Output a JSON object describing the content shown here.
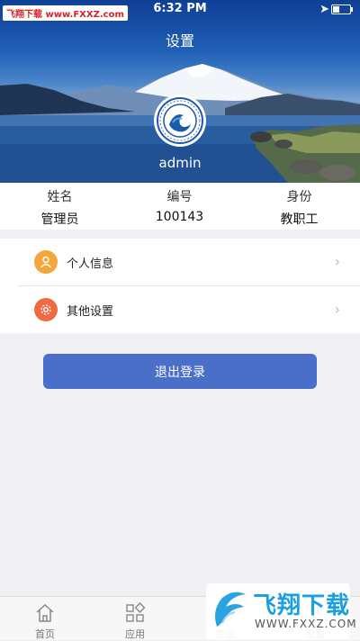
{
  "watermark": {
    "top_text": "飞翔下载 www.FXXZ.com",
    "bottom_brand": "飞翔下载",
    "bottom_url": "WWW.FXXZ.COM"
  },
  "status_bar": {
    "time": "6:32 PM",
    "location_icon": "location-arrow-icon",
    "battery_icon": "battery-icon"
  },
  "header": {
    "title": "设置",
    "username": "admin",
    "avatar_icon": "school-emblem-icon"
  },
  "info": {
    "columns": [
      {
        "label": "姓名",
        "value": "管理员"
      },
      {
        "label": "编号",
        "value": "100143"
      },
      {
        "label": "身份",
        "value": "教职工"
      }
    ]
  },
  "menu": {
    "items": [
      {
        "label": "个人信息",
        "icon": "person-icon",
        "color": "#f4a63a"
      },
      {
        "label": "其他设置",
        "icon": "gear-icon",
        "color": "#ec6a44"
      }
    ]
  },
  "logout": {
    "label": "退出登录",
    "color": "#4a6fc9"
  },
  "tabbar": {
    "tabs": [
      {
        "label": "首页",
        "icon": "home-icon"
      },
      {
        "label": "应用",
        "icon": "apps-grid-icon"
      },
      {
        "label": "发现",
        "icon": "discover-icon"
      },
      {
        "label": "设置",
        "icon": "settings-icon",
        "active": true
      }
    ]
  },
  "colors": {
    "accent": "#4a6fc9",
    "background": "#efeff4"
  }
}
